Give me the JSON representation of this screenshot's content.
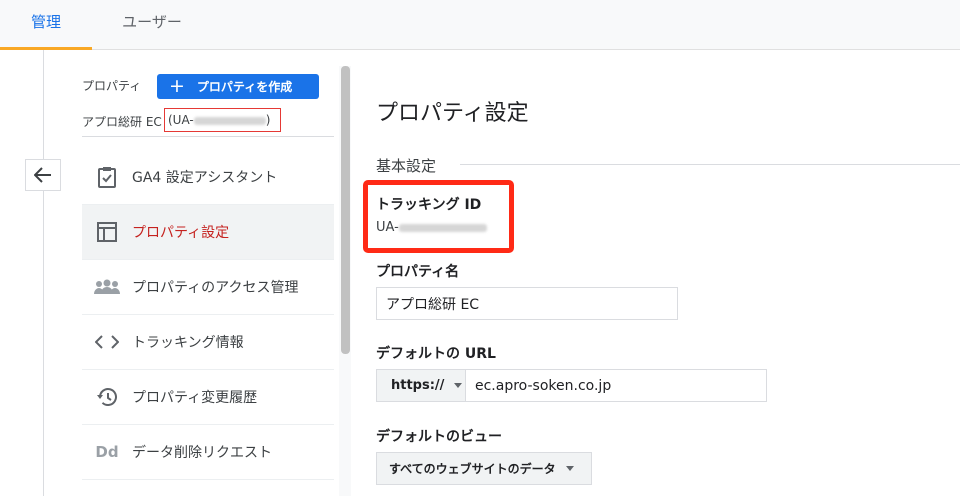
{
  "tabs": [
    {
      "label": "管理"
    },
    {
      "label": "ユーザー"
    }
  ],
  "property": {
    "label": "プロパティ",
    "create_button": "プロパティを作成",
    "name": "アプロ総研 EC",
    "id_prefix": "(UA-",
    "id_suffix": ")"
  },
  "nav": [
    {
      "label": "GA4 設定アシスタント",
      "icon": "clipboard-check-icon"
    },
    {
      "label": "プロパティ設定",
      "icon": "layout-icon"
    },
    {
      "label": "プロパティのアクセス管理",
      "icon": "people-icon"
    },
    {
      "label": "トラッキング情報",
      "icon": "code-icon"
    },
    {
      "label": "プロパティ変更履歴",
      "icon": "history-icon"
    },
    {
      "label": "データ削除リクエスト",
      "icon": "dd-icon"
    }
  ],
  "main": {
    "title": "プロパティ設定",
    "section": "基本設定",
    "tracking_label": "トラッキング ID",
    "tracking_prefix": "UA-",
    "property_name_label": "プロパティ名",
    "property_name_value": "アプロ総研 EC",
    "default_url_label": "デフォルトの URL",
    "protocol": "https://",
    "url_value": "ec.apro-soken.co.jp",
    "default_view_label": "デフォルトのビュー",
    "default_view_value": "すべてのウェブサイトのデータ"
  },
  "colors": {
    "accent": "#1a73e8",
    "selected_text": "#c5221f",
    "highlight_border": "#ff2a16",
    "tab_underline": "#f9a825"
  }
}
